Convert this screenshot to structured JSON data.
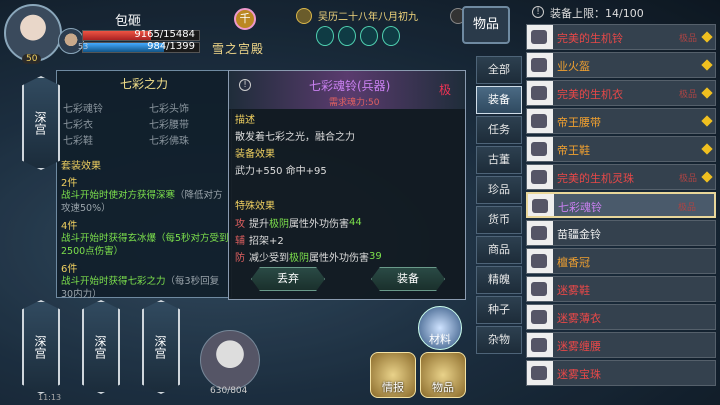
{
  "player": {
    "name": "包砸",
    "hp": "9165/15484",
    "hp_frac": 0.59,
    "mp": "984/1399",
    "mp_frac": 0.7,
    "level": "50",
    "sub_level": "53"
  },
  "map": {
    "gourd": "千",
    "location": "雪之宫殿"
  },
  "calendar": {
    "date": "吴历二十八年八月初九"
  },
  "bag": {
    "tab_label": "物品",
    "capacity": "装备上限：14/100"
  },
  "set_panel": {
    "title": "七彩之力",
    "pieces": [
      "七彩魂铃",
      "七彩头饰",
      "七彩衣",
      "七彩腰带",
      "七彩鞋",
      "七彩佛珠"
    ],
    "header": "套装效果",
    "tiers": [
      {
        "n": "2件",
        "pre": "战斗开始时使对方获得",
        "key": "深寒",
        "post": "（降低对方攻速50%）"
      },
      {
        "n": "4件",
        "pre": "战斗开始时获得玄冰爆（每5秒对方受到2500点伤害）",
        "key": "",
        "post": ""
      },
      {
        "n": "6件",
        "pre": "战斗开始时获得",
        "key": "七彩之力",
        "post": "（每3秒回复30内力）"
      }
    ]
  },
  "side_tiles": [
    "深宫",
    "深宫",
    "深宫",
    "深宫"
  ],
  "item": {
    "name": "七彩魂铃(兵器)",
    "requirement": "需求魂力:50",
    "badge": "极",
    "desc_label": "描述",
    "desc": "散发着七彩之光，融合之力",
    "equip_label": "装备效果",
    "equip": "武力+550   命中+95",
    "special_label": "特殊效果",
    "effects": [
      {
        "k": "攻",
        "pre": "提升",
        "key": "极阴",
        "post": "属性外功伤害",
        "val": "44"
      },
      {
        "k": "辅",
        "pre": "招架+2",
        "key": "",
        "post": "",
        "val": ""
      },
      {
        "k": "防",
        "pre": "减少受到",
        "key": "极阴",
        "post": "属性外功伤害",
        "val": "39"
      }
    ],
    "discard_label": "丢弃",
    "equip_button_label": "装备"
  },
  "categories": [
    "全部",
    "装备",
    "任务",
    "古董",
    "珍品",
    "货币",
    "商品",
    "精魄",
    "种子",
    "杂物"
  ],
  "selected_category": "装备",
  "items": [
    {
      "name": "完美的生机铃",
      "color": "#e84848",
      "tag": "极品",
      "diamond": true
    },
    {
      "name": "业火盔",
      "color": "#f0a030",
      "tag": "",
      "diamond": true
    },
    {
      "name": "完美的生机衣",
      "color": "#e84848",
      "tag": "极品",
      "diamond": true
    },
    {
      "name": "帝王腰带",
      "color": "#f0a030",
      "tag": "",
      "diamond": true
    },
    {
      "name": "帝王鞋",
      "color": "#f0a030",
      "tag": "",
      "diamond": true
    },
    {
      "name": "完美的生机灵珠",
      "color": "#e84848",
      "tag": "极品",
      "diamond": true
    },
    {
      "name": "七彩魂铃",
      "color": "#c980f0",
      "tag": "极品",
      "diamond": false
    },
    {
      "name": "苗疆金铃",
      "color": "#eeeeee",
      "tag": "",
      "diamond": false
    },
    {
      "name": "檀香冠",
      "color": "#f0a030",
      "tag": "",
      "diamond": false
    },
    {
      "name": "迷雾鞋",
      "color": "#e84848",
      "tag": "",
      "diamond": false
    },
    {
      "name": "迷雾薄衣",
      "color": "#e84848",
      "tag": "",
      "diamond": false
    },
    {
      "name": "迷雾缠腰",
      "color": "#e84848",
      "tag": "",
      "diamond": false
    },
    {
      "name": "迷雾宝珠",
      "color": "#e84848",
      "tag": "",
      "diamond": false
    }
  ],
  "bottom": {
    "pet_food": "630/804",
    "materials": "材料",
    "intel": "情报",
    "goods": "物品",
    "clock": "11:13"
  }
}
